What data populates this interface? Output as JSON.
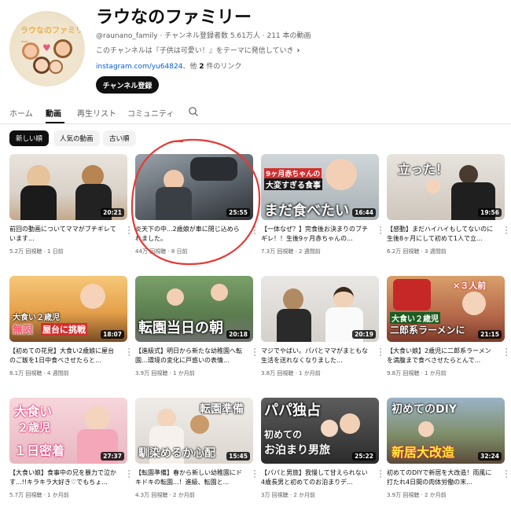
{
  "channel": {
    "title": "ラウなのファミリー",
    "handle": "@raunano_family",
    "subscribers": "チャンネル登録者数 5.61万人",
    "video_count": "211 本の動画",
    "description": "このチャンネルは『子供は可愛い！』をテーマに発信していき",
    "link": "instagram.com/yu64824",
    "link_more_prefix": "、他 ",
    "link_more_count": "2",
    "link_more_suffix": " 件のリンク",
    "subscribe_label": "チャンネル登録",
    "avatar_logo": "ラウなのファミリー"
  },
  "tabs": [
    "ホーム",
    "動画",
    "再生リスト",
    "コミュニティ"
  ],
  "active_tab": "動画",
  "chips": [
    "新しい順",
    "人気の動画",
    "古い順"
  ],
  "videos": [
    {
      "title": "前回の動画についてママがブチギレています...",
      "views": "5.2万 回視聴",
      "age": "1 日前",
      "duration": "20:21",
      "thumb_text": ""
    },
    {
      "title": "炎天下の中...2歳娘が車に閉じ込められました。",
      "views": "44万 回視聴",
      "age": "8 日前",
      "duration": "25:55",
      "thumb_text": ""
    },
    {
      "title": "【一体なぜ？】完食後お決まりのブチギレ！！生後9ヶ月赤ちゃんの...",
      "views": "7.3万 回視聴",
      "age": "2 週間前",
      "duration": "16:44",
      "thumb_text": "まだ食べたい",
      "thumb_text2": "大変すぎる食事",
      "thumb_text3": "9ヶ月赤ちゃんの"
    },
    {
      "title": "【感動】まだハイハイもしてないのに生後8ヶ月にして初めて1人で立...",
      "views": "6.2万 回視聴",
      "age": "3 週間前",
      "duration": "19:56",
      "thumb_text": "立った！"
    },
    {
      "title": "【初めての花見】大食い2歳娘に屋台のご飯を1日中食べさせたらと...",
      "views": "8.1万 回視聴",
      "age": "4 週間前",
      "duration": "18:07",
      "thumb_text": "屋台に挑戦",
      "thumb_text2": "大食い２歳児",
      "thumb_text3": "無限"
    },
    {
      "title": "【進級式】明日から新たな幼稚園へ転園…環境の変化に戸惑いの表情...",
      "views": "3.9万 回視聴",
      "age": "1 か月前",
      "duration": "20:18",
      "thumb_text": "転園当日の朝"
    },
    {
      "title": "マジでやばい。パパとママがまともな生活を送れなくなりました...",
      "views": "3.8万 回視聴",
      "age": "1 か月前",
      "duration": "20:19",
      "thumb_text": ""
    },
    {
      "title": "【大食い娘】2歳児に二郎系ラーメンを満腹まで食べさせたらとんで...",
      "views": "9.8万 回視聴",
      "age": "1 か月前",
      "duration": "21:15",
      "thumb_text": "二郎系ラーメンに",
      "thumb_text2": "大食い２歳児",
      "thumb_text3": "×３人前"
    },
    {
      "title": "【大食い娘】食事中の兄を暴力で泣かす...!!キラキラ大好き♡でもちょ...",
      "views": "5.7万 回視聴",
      "age": "1 か月前",
      "duration": "27:37",
      "thumb_text": "大食い",
      "thumb_text2": "２歳児",
      "thumb_text3": "１日密着"
    },
    {
      "title": "【転園準備】春から新しい幼稚園にドキドキの転園...！進級、転園と...",
      "views": "4.3万 回視聴",
      "age": "2 か月前",
      "duration": "15:45",
      "thumb_text": "転園準備",
      "thumb_text2": "馴染めるか心配"
    },
    {
      "title": "【パパと男旅】我慢して甘えられない4歳長男と初めてのお泊まりデ...",
      "views": "3万 回視聴",
      "age": "2 か月前",
      "duration": "25:22",
      "thumb_text": "パパ独占",
      "thumb_text2": "初めての",
      "thumb_text3": "お泊まり男旅"
    },
    {
      "title": "初めてのDIYで新居を大改造！雨風に打たれ4日間の肉体労働の末...",
      "views": "3.9万 回視聴",
      "age": "2 か月前",
      "duration": "32:24",
      "thumb_text": "初めてのDIY",
      "thumb_text2": "新居大改造"
    }
  ],
  "colors": {
    "accent": "#065fd4",
    "annotation": "#e53935",
    "dark": "#0f0f0f",
    "meta": "#606060"
  }
}
